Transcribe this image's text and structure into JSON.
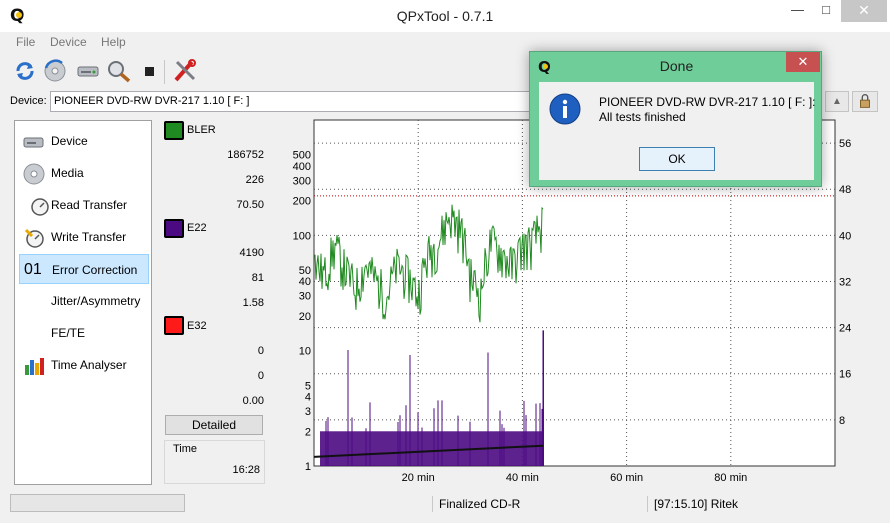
{
  "window": {
    "title": "QPxTool - 0.7.1",
    "minimize": "—",
    "maximize": "□",
    "close": "✕"
  },
  "menu": [
    "File",
    "Device",
    "Help"
  ],
  "toolbar": {
    "buttons": [
      "refresh-icon",
      "disc-refresh-icon",
      "device-info-icon",
      "scan-icon",
      "stop-icon",
      "settings-tools-icon"
    ]
  },
  "device": {
    "label": "Device:",
    "value": "PIONEER  DVD-RW  DVR-217  1.10 [ F: ]",
    "eject": "▲"
  },
  "sidebar": {
    "items": [
      {
        "label": "Device",
        "icon": "device-icon"
      },
      {
        "label": "Media",
        "icon": "media-disc-icon"
      },
      {
        "label": "Read Transfer",
        "icon": "read-transfer-icon"
      },
      {
        "label": "Write Transfer",
        "icon": "write-transfer-icon"
      },
      {
        "label": "Error Correction",
        "icon": "error-correction-icon",
        "prefix": "01"
      },
      {
        "label": "Jitter/Asymmetry",
        "icon": ""
      },
      {
        "label": "FE/TE",
        "icon": ""
      },
      {
        "label": "Time Analyser",
        "icon": "time-analyser-icon"
      }
    ]
  },
  "stats": {
    "bler": {
      "name": "BLER",
      "color": "#1f8a1f",
      "values": [
        "186752",
        "226",
        "70.50"
      ]
    },
    "e22": {
      "name": "E22",
      "color": "#4b0a82",
      "values": [
        "4190",
        "81",
        "1.58"
      ]
    },
    "e32": {
      "name": "E32",
      "color": "#ff1a1a",
      "values": [
        "0",
        "0",
        "0.00"
      ]
    },
    "detailed_label": "Detailed",
    "time_label": "Time",
    "time_value": "16:28"
  },
  "chart_data": {
    "type": "line",
    "x_unit": "min",
    "xlim": [
      0,
      100
    ],
    "x_ticks": [
      20,
      40,
      60,
      80
    ],
    "x_tick_labels": [
      "20 min",
      "40 min",
      "60 min",
      "80 min"
    ],
    "y_left_scale": "log",
    "y_left_lim": [
      1,
      1000
    ],
    "y_left_ticks": [
      1,
      2,
      3,
      4,
      5,
      10,
      20,
      30,
      40,
      50,
      100,
      200,
      300,
      400,
      500
    ],
    "y_right_lim": [
      0,
      60
    ],
    "y_right_ticks": [
      8,
      16,
      24,
      32,
      40,
      48,
      56
    ],
    "threshold_line": 220,
    "scanned_until_min": 44,
    "series": [
      {
        "name": "BLER",
        "color": "#1f8a1f",
        "x": [
          0,
          2,
          4,
          6,
          8,
          10,
          12,
          14,
          16,
          18,
          20,
          22,
          24,
          26,
          28,
          30,
          32,
          34,
          36,
          38,
          40,
          42,
          44
        ],
        "y": [
          60,
          45,
          80,
          50,
          35,
          55,
          40,
          30,
          55,
          45,
          30,
          70,
          90,
          150,
          120,
          45,
          30,
          90,
          70,
          55,
          80,
          90,
          130
        ]
      },
      {
        "name": "E22",
        "color": "#4b0a82",
        "x": [
          0,
          5,
          10,
          15,
          20,
          25,
          30,
          35,
          40,
          44
        ],
        "y": [
          1.5,
          1.8,
          1.9,
          1.8,
          1.9,
          1.8,
          1.9,
          1.8,
          1.9,
          2.0
        ]
      },
      {
        "name": "Speed",
        "color": "#111111",
        "axis": "right",
        "x": [
          0,
          44
        ],
        "y": [
          1.2,
          1.5
        ]
      }
    ]
  },
  "status": {
    "disc_type": "Finalized CD-R",
    "media_id": "[97:15.10] Ritek"
  },
  "dialog": {
    "title": "Done",
    "close": "✕",
    "message_line1": "PIONEER  DVD-RW  DVR-217  1.10 [ F: ]:",
    "message_line2": "All tests finished",
    "ok_label": "OK"
  }
}
